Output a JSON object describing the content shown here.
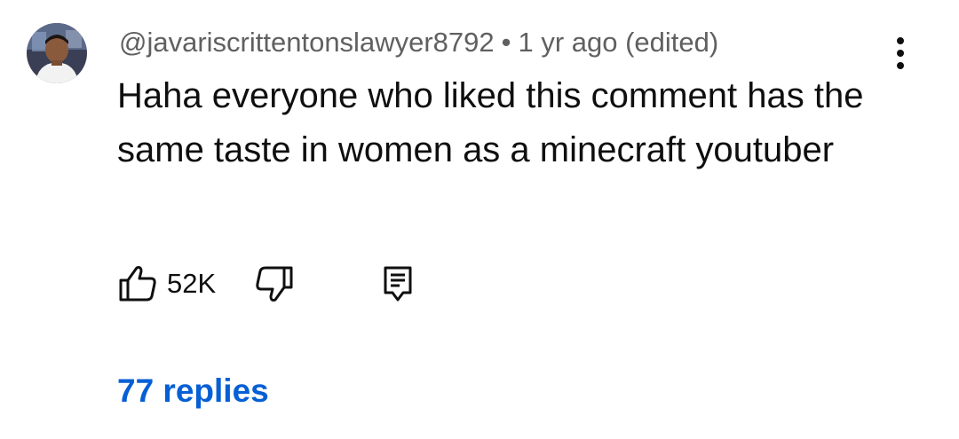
{
  "comment": {
    "author_handle": "@javariscrittentonslawyer8792",
    "separator": "•",
    "timestamp": "1 yr ago (edited)",
    "text": "Haha everyone who liked this comment has the same taste in women as a minecraft youtuber",
    "like_count": "52K",
    "replies_label": "77 replies"
  },
  "icons": {
    "avatar": "user-avatar-photo",
    "menu": "vertical-ellipsis-icon",
    "like": "thumbs-up-icon",
    "dislike": "thumbs-down-icon",
    "reply": "reply-comment-icon"
  },
  "colors": {
    "meta_text": "#606060",
    "body_text": "#0f0f0f",
    "link": "#065fd4"
  }
}
